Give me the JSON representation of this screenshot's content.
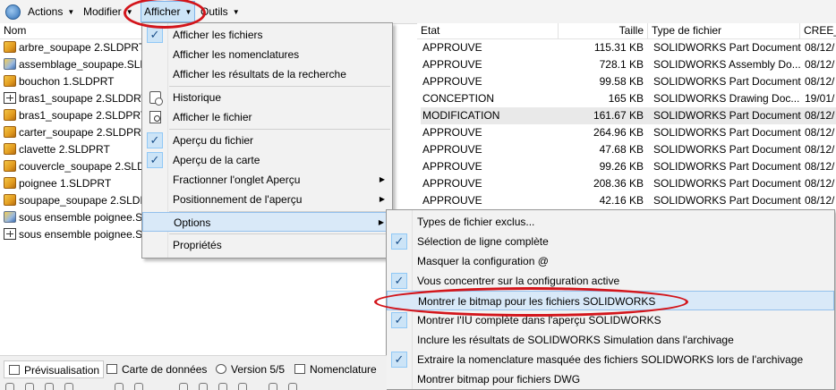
{
  "menubar": {
    "actions": "Actions",
    "modifier": "Modifier",
    "afficher": "Afficher",
    "outils": "Outils"
  },
  "columns": {
    "nom": "Nom",
    "etat": "Etat",
    "taille": "Taille",
    "type": "Type de fichier",
    "cree": "CREE_L"
  },
  "files": [
    {
      "name": "arbre_soupape 2.SLDPRT",
      "icon": "part-icon",
      "state": "APPROUVE",
      "size": "115.31 KB",
      "type": "SOLIDWORKS Part Document",
      "date": "08/12/"
    },
    {
      "name": "assemblage_soupape.SLD",
      "icon": "assembly-icon",
      "state": "APPROUVE",
      "size": "728.1 KB",
      "type": "SOLIDWORKS Assembly Do...",
      "date": "08/12/"
    },
    {
      "name": "bouchon 1.SLDPRT",
      "icon": "part-icon",
      "state": "APPROUVE",
      "size": "99.58 KB",
      "type": "SOLIDWORKS Part Document",
      "date": "08/12/"
    },
    {
      "name": "bras1_soupape 2.SLDDRW",
      "icon": "drawing-icon",
      "state": "CONCEPTION",
      "size": "165 KB",
      "type": "SOLIDWORKS Drawing Doc...",
      "date": "19/01/"
    },
    {
      "name": "bras1_soupape 2.SLDPRT",
      "icon": "part-icon",
      "state": "MODIFICATION",
      "size": "161.67 KB",
      "type": "SOLIDWORKS Part Document",
      "date": "08/12/"
    },
    {
      "name": "carter_soupape 2.SLDPRT",
      "icon": "part-icon",
      "state": "APPROUVE",
      "size": "264.96 KB",
      "type": "SOLIDWORKS Part Document",
      "date": "08/12/"
    },
    {
      "name": "clavette 2.SLDPRT",
      "icon": "part-icon",
      "state": "APPROUVE",
      "size": "47.68 KB",
      "type": "SOLIDWORKS Part Document",
      "date": "08/12/"
    },
    {
      "name": "couvercle_soupape 2.SLD",
      "icon": "part-icon",
      "state": "APPROUVE",
      "size": "99.26 KB",
      "type": "SOLIDWORKS Part Document",
      "date": "08/12/"
    },
    {
      "name": "poignee 1.SLDPRT",
      "icon": "part-icon",
      "state": "APPROUVE",
      "size": "208.36 KB",
      "type": "SOLIDWORKS Part Document",
      "date": "08/12/"
    },
    {
      "name": "soupape_soupape 2.SLDP",
      "icon": "part-icon",
      "state": "APPROUVE",
      "size": "42.16 KB",
      "type": "SOLIDWORKS Part Document",
      "date": "08/12/"
    },
    {
      "name": "sous ensemble poignee.S",
      "icon": "assembly-icon"
    },
    {
      "name": "sous ensemble poignee.S",
      "icon": "drawing-icon"
    }
  ],
  "afficher_menu": {
    "afficher_fichiers": "Afficher les fichiers",
    "afficher_nomenclatures": "Afficher les nomenclatures",
    "afficher_resultats": "Afficher les résultats de la recherche",
    "historique": "Historique",
    "afficher_fichier": "Afficher le fichier",
    "apercu_fichier": "Aperçu du fichier",
    "apercu_carte": "Aperçu de la carte",
    "fractionner": "Fractionner l'onglet Aperçu",
    "positionnement": "Positionnement de l'aperçu",
    "options": "Options",
    "proprietes": "Propriétés"
  },
  "options_menu": {
    "types_exclus": "Types de fichier exclus...",
    "selection_ligne": "Sélection de ligne complète",
    "masquer_config": "Masquer la configuration @",
    "concentrer_config": "Vous concentrer sur la configuration active",
    "montrer_bitmap": "Montrer le bitmap pour les fichiers SOLIDWORKS",
    "montrer_iu": "Montrer l'IU complète dans l'aperçu SOLIDWORKS",
    "inclure_simulation": "Inclure les résultats de SOLIDWORKS Simulation dans l'archivage",
    "extraire_nomenclature": "Extraire la nomenclature masquée des fichiers SOLIDWORKS lors de l'archivage",
    "bitmap_dwg": "Montrer bitmap pour fichiers DWG"
  },
  "tabs": {
    "previsualisation": "Prévisualisation",
    "carte_donnees": "Carte de données",
    "version": "Version 5/5",
    "nomenclature": "Nomenclature"
  },
  "colors": {
    "highlight_ring": "#d3151b",
    "menu_hover": "#d9e9f8",
    "check_bg": "#cce4f7"
  }
}
